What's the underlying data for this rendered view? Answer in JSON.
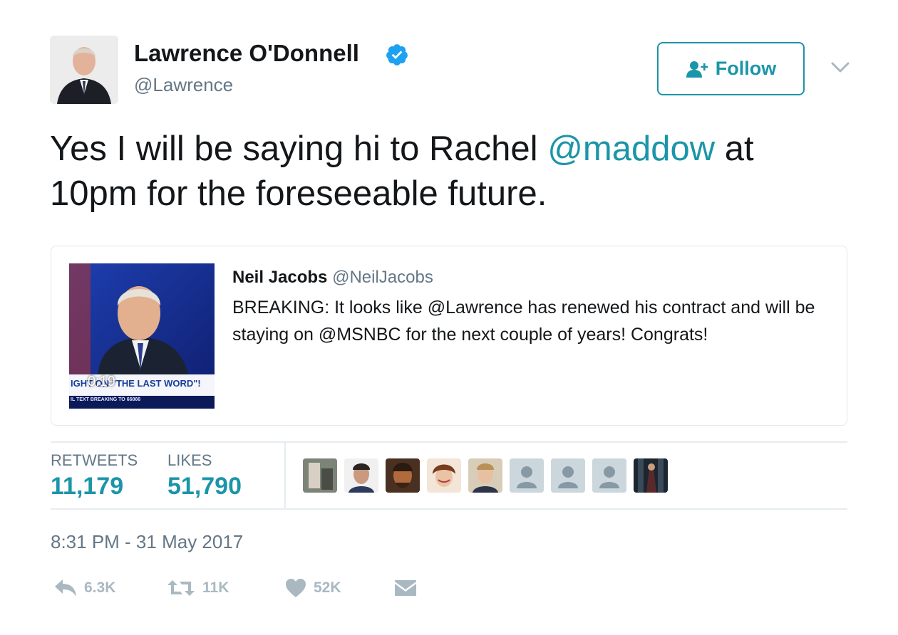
{
  "author": {
    "display_name": "Lawrence O'Donnell",
    "handle": "@Lawrence",
    "verified": true,
    "avatar_icon": "profile-photo"
  },
  "follow_button": {
    "label": "Follow",
    "icon": "add-user-icon"
  },
  "menu": {
    "icon": "chevron-down-icon"
  },
  "tweet": {
    "text_before": "Yes I will be saying hi to Rachel ",
    "mention": "@maddow",
    "text_after": " at 10pm for the foreseeable future."
  },
  "quoted_tweet": {
    "name": "Neil Jacobs",
    "handle": "@NeilJacobs",
    "text": "BREAKING: It looks like @Lawrence has renewed his contract and will be staying on @MSNBC for the next couple of years! Congrats!",
    "video": {
      "duration": "0:19",
      "chyron": "IGHT ON \"THE LAST WORD\"!",
      "ticker": "IL TEXT BREAKING TO 66866"
    }
  },
  "stats": {
    "retweets_label": "RETWEETS",
    "retweets_count": "11,179",
    "likes_label": "LIKES",
    "likes_count": "51,790"
  },
  "timestamp": "8:31 PM - 31 May 2017",
  "actions": {
    "reply_count": "6.3K",
    "retweet_count": "11K",
    "like_count": "52K"
  },
  "colors": {
    "accent": "#1b95a8",
    "verified": "#1da1f2",
    "muted": "#657786",
    "action_gray": "#aab8c2"
  }
}
